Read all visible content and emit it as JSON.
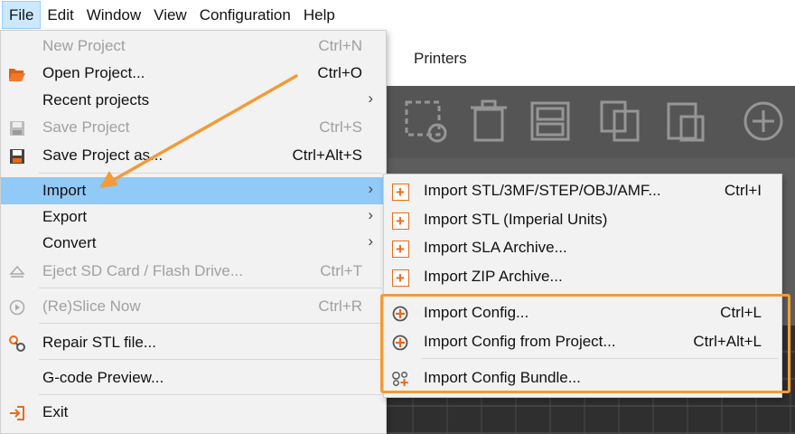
{
  "menubar": {
    "items": [
      {
        "label": "File"
      },
      {
        "label": "Edit"
      },
      {
        "label": "Window"
      },
      {
        "label": "View"
      },
      {
        "label": "Configuration"
      },
      {
        "label": "Help"
      }
    ]
  },
  "app": {
    "tab_printers": "Printers"
  },
  "file_menu": {
    "new_project": {
      "label": "New Project",
      "shortcut": "Ctrl+N"
    },
    "open_project": {
      "label": "Open Project...",
      "shortcut": "Ctrl+O"
    },
    "recent_projects": {
      "label": "Recent projects"
    },
    "save_project": {
      "label": "Save Project",
      "shortcut": "Ctrl+S"
    },
    "save_project_as": {
      "label": "Save Project as...",
      "shortcut": "Ctrl+Alt+S"
    },
    "import": {
      "label": "Import"
    },
    "export": {
      "label": "Export"
    },
    "convert": {
      "label": "Convert"
    },
    "eject": {
      "label": "Eject SD Card / Flash Drive...",
      "shortcut": "Ctrl+T"
    },
    "reslice": {
      "label": "(Re)Slice Now",
      "shortcut": "Ctrl+R"
    },
    "repair": {
      "label": "Repair STL file..."
    },
    "gcode_preview": {
      "label": "G-code Preview..."
    },
    "exit": {
      "label": "Exit"
    },
    "submenu_arrow": "›"
  },
  "import_menu": {
    "import_stl": {
      "label": "Import STL/3MF/STEP/OBJ/AMF...",
      "shortcut": "Ctrl+I"
    },
    "import_stl_imperial": {
      "label": "Import STL (Imperial Units)"
    },
    "import_sla": {
      "label": "Import SLA Archive..."
    },
    "import_zip": {
      "label": "Import ZIP Archive..."
    },
    "import_config": {
      "label": "Import Config...",
      "shortcut": "Ctrl+L"
    },
    "import_config_project": {
      "label": "Import Config from Project...",
      "shortcut": "Ctrl+Alt+L"
    },
    "import_config_bundle": {
      "label": "Import Config Bundle..."
    }
  },
  "colors": {
    "accent_orange": "#f29b38",
    "icon_orange": "#e96a1a",
    "highlight_blue": "#91c9f7"
  }
}
